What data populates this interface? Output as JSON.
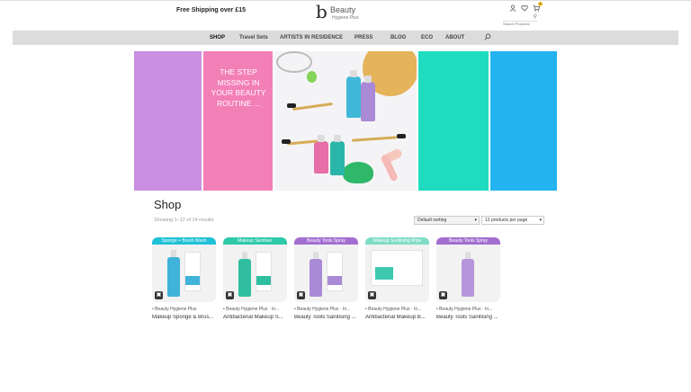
{
  "header": {
    "shipping_text": "Free Shipping over £15",
    "logo_mark": "b",
    "logo_line1": "Beauty",
    "logo_line2": "Hygiene Plus",
    "icons": [
      "user-icon",
      "heart-icon",
      "cart-icon"
    ],
    "cart_count": "0",
    "search_placeholder": "Search Products"
  },
  "nav": {
    "items": [
      {
        "label": "SHOP",
        "active": true
      },
      {
        "label": "Travel Sets",
        "active": false
      },
      {
        "label": "ARTISTS IN RESIDENCE",
        "active": false
      },
      {
        "label": "PRESS",
        "active": false
      },
      {
        "label": "BLOG",
        "active": false
      },
      {
        "label": "ECO",
        "active": false
      },
      {
        "label": "ABOUT",
        "active": false
      }
    ]
  },
  "banner": {
    "text": "THE STEP MISSING IN YOUR BEAUTY ROUTINE ...",
    "colors": {
      "purple": "#c98fe0",
      "pink": "#f37fb7",
      "teal": "#1fdcc0",
      "blue": "#23b3ee"
    }
  },
  "shop": {
    "title": "Shop",
    "result_count": "Showing 1–12 of 14 results",
    "sort_value": "Default sorting",
    "per_page_value": "12 products per page"
  },
  "products": [
    {
      "tag": "Sponge + Brush Wash",
      "tag_color": "#1fc1d6",
      "brand": "Beauty Hygiene Plus",
      "name": "Makeup Sponge & Brus...",
      "bottle_color": "#3fb3d9"
    },
    {
      "tag": "Makeup Sanitiser",
      "tag_color": "#2ec9a8",
      "brand": "Beauty Hygiene Plus · In...",
      "name": "Antibacterial Makeup S...",
      "bottle_color": "#2fbfa0"
    },
    {
      "tag": "Beauty Tools Spray",
      "tag_color": "#a36ed0",
      "brand": "Beauty Hygiene Plus · In...",
      "name": "Beauty Tools Sanitising ...",
      "bottle_color": "#a98ad6"
    },
    {
      "tag": "Makeup Sanitising Wipe",
      "tag_color": "#7fdcc6",
      "brand": "Beauty Hygiene Plus · In...",
      "name": "Antibacterial Makeup B...",
      "bottle_color": "#3dc9b0"
    },
    {
      "tag": "Beauty Tools Spray",
      "tag_color": "#a36ed0",
      "brand": "Beauty Hygiene Plus · In...",
      "name": "Beauty Tools Sanitising ...",
      "bottle_color": "#b596db"
    }
  ]
}
